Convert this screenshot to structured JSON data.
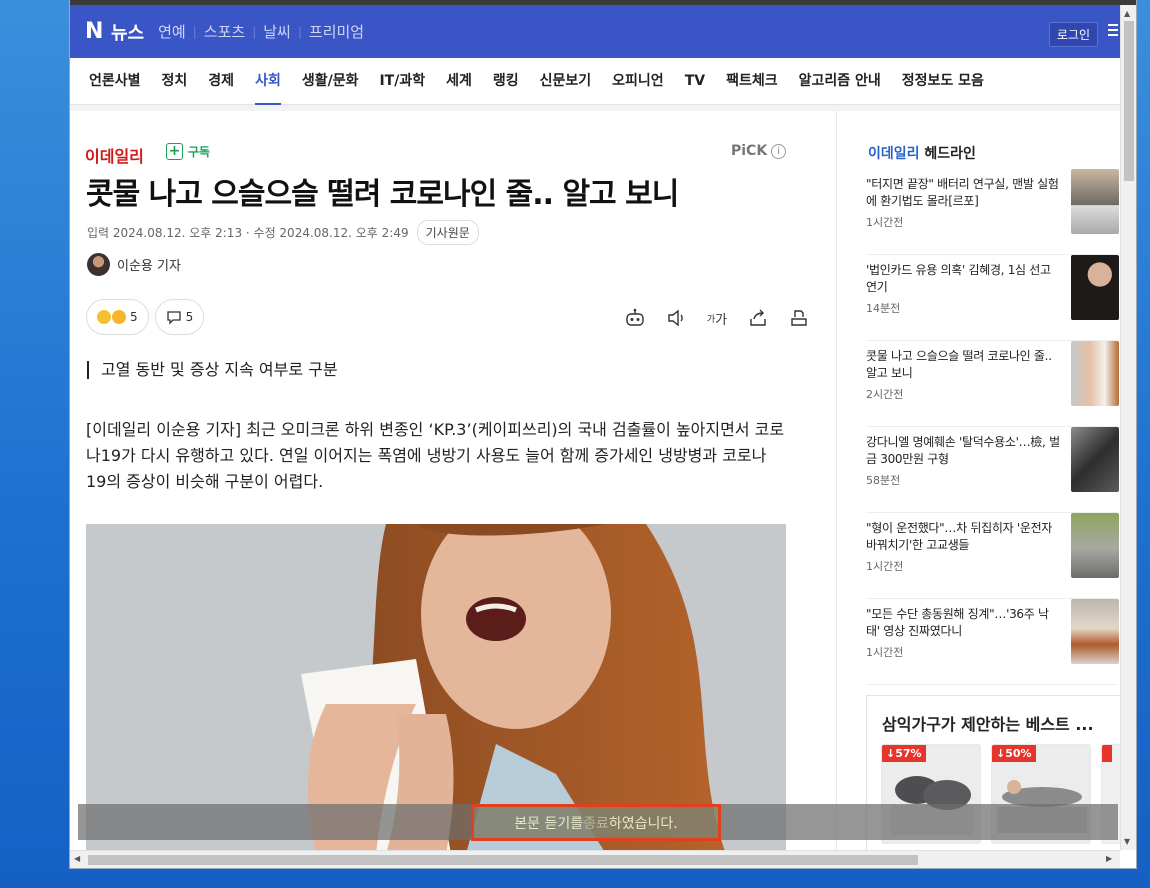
{
  "nav": {
    "logo_n": "N",
    "logo_text": "뉴스",
    "links": [
      "연예",
      "스포츠",
      "날씨",
      "프리미엄"
    ],
    "login": "로그인"
  },
  "categories": [
    "언론사별",
    "정치",
    "경제",
    "사회",
    "생활/문화",
    "IT/과학",
    "세계",
    "랭킹",
    "신문보기",
    "오피니언",
    "TV",
    "팩트체크",
    "알고리즘 안내",
    "정정보도 모음"
  ],
  "active_category": "사회",
  "article": {
    "press": "이데일리",
    "subscribe": "구독",
    "pick": "PiCK",
    "pick_info": "i",
    "headline": "콧물 나고 으슬으슬 떨려 코로나인 줄.. 알고 보니",
    "input_date": "입력 2024.08.12. 오후 2:13",
    "edit_date": "수정 2024.08.12. 오후 2:49",
    "original_link": "기사원문",
    "reporter": "이순용 기자",
    "reaction_count": "5",
    "comment_count": "5",
    "font_tool_label": "가",
    "summary": "고열 동반 및 증상 지속 여부로 구분",
    "body": "[이데일리 이순용 기자] 최근 오미크론 하위 변종인 ‘KP.3’(케이피쓰리)의 국내 검출률이 높아지면서 코로나19가 다시 유행하고 있다. 연일 이어지는 폭염에 냉방기 사용도 늘어 함께 증가세인 냉방병과 코로나19의 증상이 비슷해 구분이 어렵다."
  },
  "sidebar": {
    "brand": "이데일리",
    "title": "헤드라인",
    "items": [
      {
        "title": "\"터지면 끝장\" 배터리 연구실, 맨발 실험에 환기법도 몰라[르포]",
        "time": "1시간전"
      },
      {
        "title": "'법인카드 유용 의혹' 김혜경, 1심 선고 연기",
        "time": "14분전"
      },
      {
        "title": "콧물 나고 으슬으슬 떨려 코로나인 줄.. 알고 보니",
        "time": "2시간전"
      },
      {
        "title": "강다니엘 명예훼손 '탈덕수용소'…檢, 벌금 300만원 구형",
        "time": "58분전"
      },
      {
        "title": "\"형이 운전했다\"…차 뒤집히자 '운전자 바꿔치기'한 고교생들",
        "time": "1시간전"
      },
      {
        "title": "\"모든 수단 총동원해 징계\"…'36주 낙태' 영상 진짜였다니",
        "time": "1시간전"
      }
    ],
    "promo_title": "삼익가구가 제안하는 베스트 ...",
    "promo_discounts": [
      "↓57%",
      "↓50%"
    ]
  },
  "toast": {
    "part1": "본문 듣기를 ",
    "part2": "종료",
    "part3": "하였습니다."
  }
}
